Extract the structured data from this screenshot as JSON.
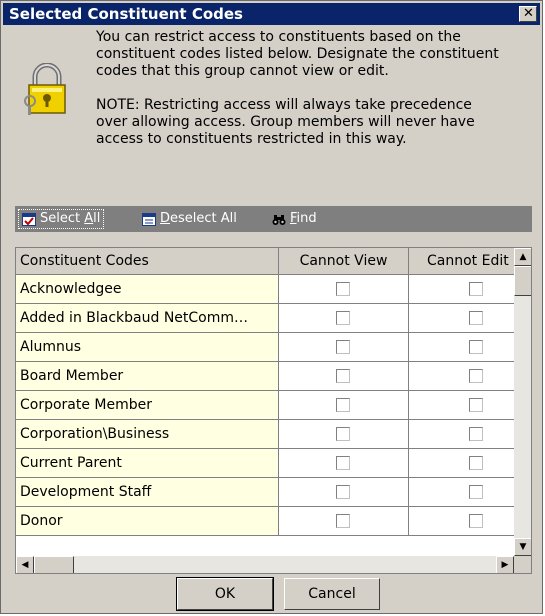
{
  "dialog": {
    "title": "Selected Constituent Codes",
    "close_glyph": "✕",
    "lock_icon": "padlock-with-keys-icon"
  },
  "message": {
    "line1": "You can restrict access to constituents based on the",
    "line2": "constituent codes listed below.  Designate the constituent",
    "line3": "codes that this group cannot view or edit.",
    "note1": "NOTE: Restricting access will always take precedence",
    "note2": "over allowing access.  Group members will never have",
    "note3": "access to constituents restricted in this way."
  },
  "toolbar": {
    "select_all_pre": "Select ",
    "select_all_key": "A",
    "select_all_post": "ll",
    "deselect_all_key": "D",
    "deselect_all_post": "eselect All",
    "find_key": "F",
    "find_post": "ind"
  },
  "grid": {
    "columns": [
      "Constituent Codes",
      "Cannot View",
      "Cannot Edit"
    ],
    "rows": [
      {
        "name": "Acknowledgee",
        "cannot_view": false,
        "cannot_edit": false
      },
      {
        "name": "Added in Blackbaud NetComm…",
        "cannot_view": false,
        "cannot_edit": false
      },
      {
        "name": "Alumnus",
        "cannot_view": false,
        "cannot_edit": false
      },
      {
        "name": "Board Member",
        "cannot_view": false,
        "cannot_edit": false
      },
      {
        "name": "Corporate Member",
        "cannot_view": false,
        "cannot_edit": false
      },
      {
        "name": "Corporation\\Business",
        "cannot_view": false,
        "cannot_edit": false
      },
      {
        "name": "Current Parent",
        "cannot_view": false,
        "cannot_edit": false
      },
      {
        "name": "Development Staff",
        "cannot_view": false,
        "cannot_edit": false
      },
      {
        "name": "Donor",
        "cannot_view": false,
        "cannot_edit": false
      }
    ]
  },
  "buttons": {
    "ok": "OK",
    "cancel": "Cancel"
  },
  "colors": {
    "title_bar": "#0a246a",
    "code_cell_background": "#ffffe1",
    "toolbar_background": "#7f7f7f",
    "dialog_background": "#d4d0c8"
  }
}
